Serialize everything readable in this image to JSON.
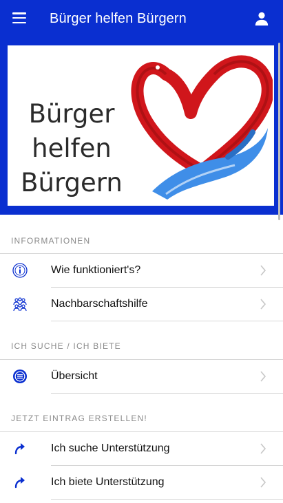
{
  "appbar": {
    "title": "Bürger helfen Bürgern",
    "menu_icon": "hamburger-menu-icon",
    "profile_icon": "person-icon",
    "color": "#0a2fd0"
  },
  "banner": {
    "logo_lines": [
      "Bürger",
      "helfen",
      "Bürgern"
    ],
    "heart_color": "#d0161b",
    "hand_color": "#3f8ee8"
  },
  "sections": [
    {
      "header": "INFORMATIONEN",
      "items": [
        {
          "label": "Wie funktioniert's?",
          "icon": "info-circle-icon"
        },
        {
          "label": "Nachbarschaftshilfe",
          "icon": "group-people-icon"
        }
      ]
    },
    {
      "header": "ICH SUCHE / ICH BIETE",
      "items": [
        {
          "label": "Übersicht",
          "icon": "list-circle-icon"
        }
      ]
    },
    {
      "header": "JETZT EINTRAG ERSTELLEN!",
      "items": [
        {
          "label": "Ich suche Unterstützung",
          "icon": "forward-arrow-icon"
        },
        {
          "label": "Ich biete Unterstützung",
          "icon": "forward-arrow-icon"
        }
      ]
    }
  ]
}
